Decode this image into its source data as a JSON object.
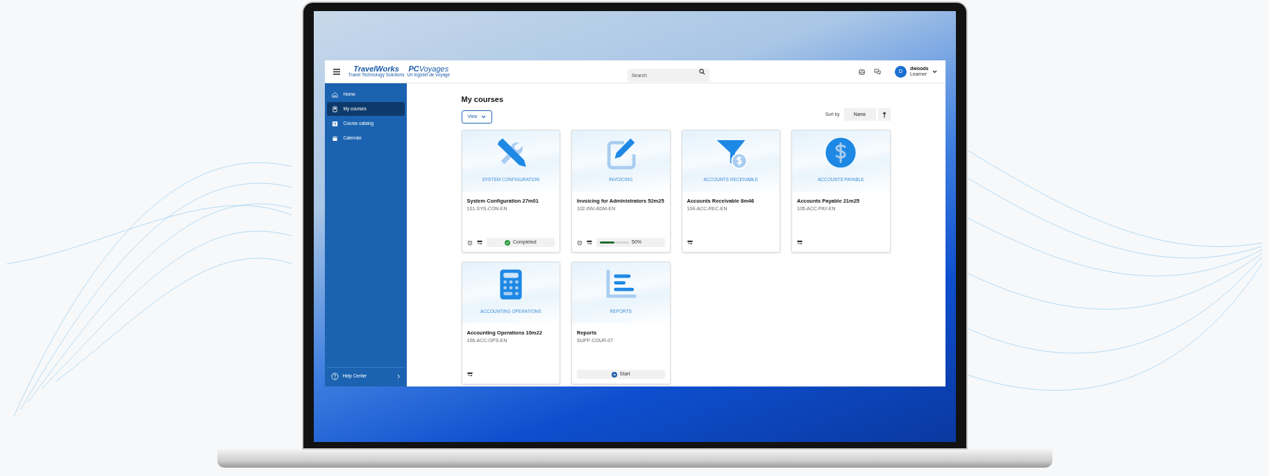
{
  "header": {
    "logo": {
      "primary": "TravelWorks",
      "primary_tagline": "Travel Technology Solutions",
      "secondary_prefix": "PC",
      "secondary": "Voyages",
      "secondary_tagline": "Un logiciel de voyage"
    },
    "search": {
      "placeholder": "Search"
    },
    "user": {
      "initial": "D",
      "name": "dwoods",
      "role": "Learner"
    }
  },
  "sidebar": {
    "items": [
      {
        "label": "Home",
        "selected": false
      },
      {
        "label": "My courses",
        "selected": true
      },
      {
        "label": "Course catalog",
        "selected": false
      },
      {
        "label": "Calendar",
        "selected": false
      }
    ],
    "help": "Help Center"
  },
  "page": {
    "title": "My courses",
    "view_button": "View",
    "sort_label": "Sort by",
    "sort_value": "Name"
  },
  "courses": [
    {
      "category": "SYSTEM CONFIGURATION",
      "title": "System Configuration 27m01",
      "code": "101-SYS-CON-EN",
      "reminder": true,
      "status": {
        "kind": "completed",
        "label": "Completed"
      }
    },
    {
      "category": "INVOICING",
      "title": "Invoicing for Administrators 52m25",
      "code": "102-INV-ADM-EN",
      "reminder": true,
      "status": {
        "kind": "progress",
        "level": 0.5,
        "reading": "50%"
      }
    },
    {
      "category": "ACCOUNTS RECEIVABLE",
      "title": "Accounts Receivable 8m46",
      "code": "104-ACC-REC-EN",
      "reminder": false,
      "status": {
        "kind": "none"
      }
    },
    {
      "category": "ACCOUNTS PAYABLE",
      "title": "Accounts Payable 21m25",
      "code": "105-ACC-PAY-EN",
      "reminder": false,
      "status": {
        "kind": "none"
      }
    },
    {
      "category": "ACCOUNTING OPERATIONS",
      "title": "Accounting Operations 10m22",
      "code": "106-ACC-OPS-EN",
      "reminder": false,
      "status": {
        "kind": "none"
      }
    },
    {
      "category": "REPORTS",
      "title": "Reports",
      "code": "SUPP-COUR-07",
      "reminder": false,
      "status": {
        "kind": "start",
        "label": "Start"
      }
    }
  ]
}
